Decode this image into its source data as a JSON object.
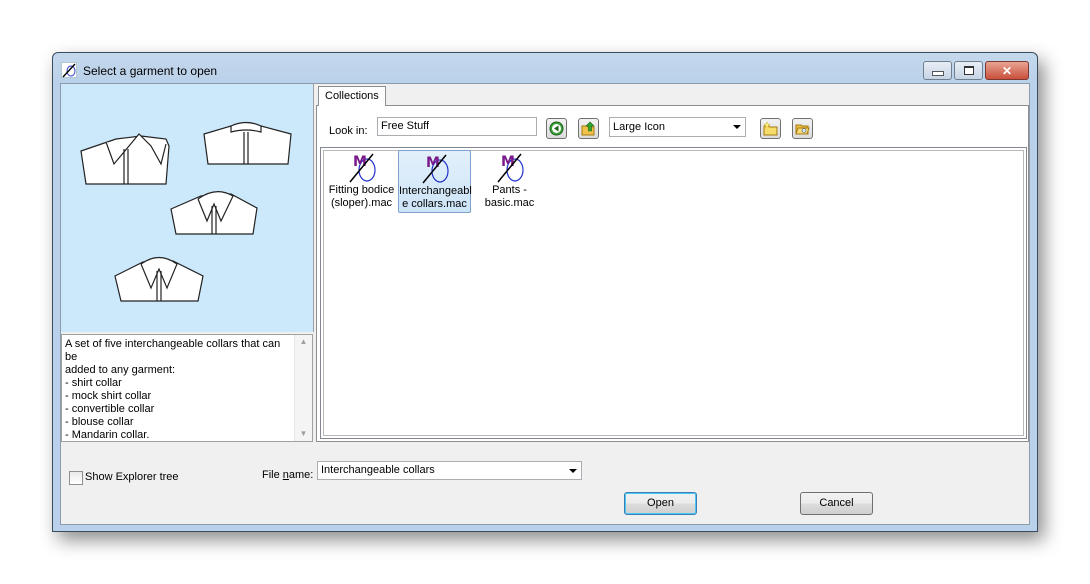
{
  "window": {
    "title": "Select a garment to open",
    "controls": {
      "minimize": "minimize",
      "maximize": "maximize",
      "close": "close"
    }
  },
  "preview": {
    "image_alt": "Four illustrated shirt collars on light blue background",
    "description": "A set of five interchangeable collars that can be\nadded to any garment:\n- shirt collar\n- mock shirt collar\n- convertible collar\n- blouse collar\n- Mandarin collar."
  },
  "tabs": [
    {
      "label": "Collections",
      "active": true
    }
  ],
  "toolbar": {
    "look_in_label": "Look in:",
    "look_in_value": "Free Stuff",
    "back_icon": "back-arrow-icon",
    "up_icon": "folder-up-icon",
    "view_mode": "Large Icon",
    "new_folder_icon": "new-folder-icon",
    "browse_icon": "browse-folder-icon"
  },
  "files": [
    {
      "name": "Fitting bodice (sloper).mac",
      "line1": "Fitting bodice",
      "line2": "(sloper).mac",
      "selected": false
    },
    {
      "name": "Interchangeable collars.mac",
      "line1": "Interchangeabl",
      "line2": "e collars.mac",
      "selected": true
    },
    {
      "name": "Pants - basic.mac",
      "line1": "Pants -",
      "line2": "basic.mac",
      "selected": false
    }
  ],
  "bottom": {
    "show_explorer_label": "Show Explorer tree",
    "show_explorer_checked": false,
    "file_name_label_pre": "File ",
    "file_name_label_accel": "n",
    "file_name_label_post": "ame:",
    "file_name_value": "Interchangeable collars",
    "open_label": "Open",
    "cancel_label": "Cancel"
  },
  "colors": {
    "preview_bg": "#cce8fb",
    "selection_border": "#7da2ce",
    "frame": "#b9d1ea",
    "close_red": "#c9503c"
  }
}
